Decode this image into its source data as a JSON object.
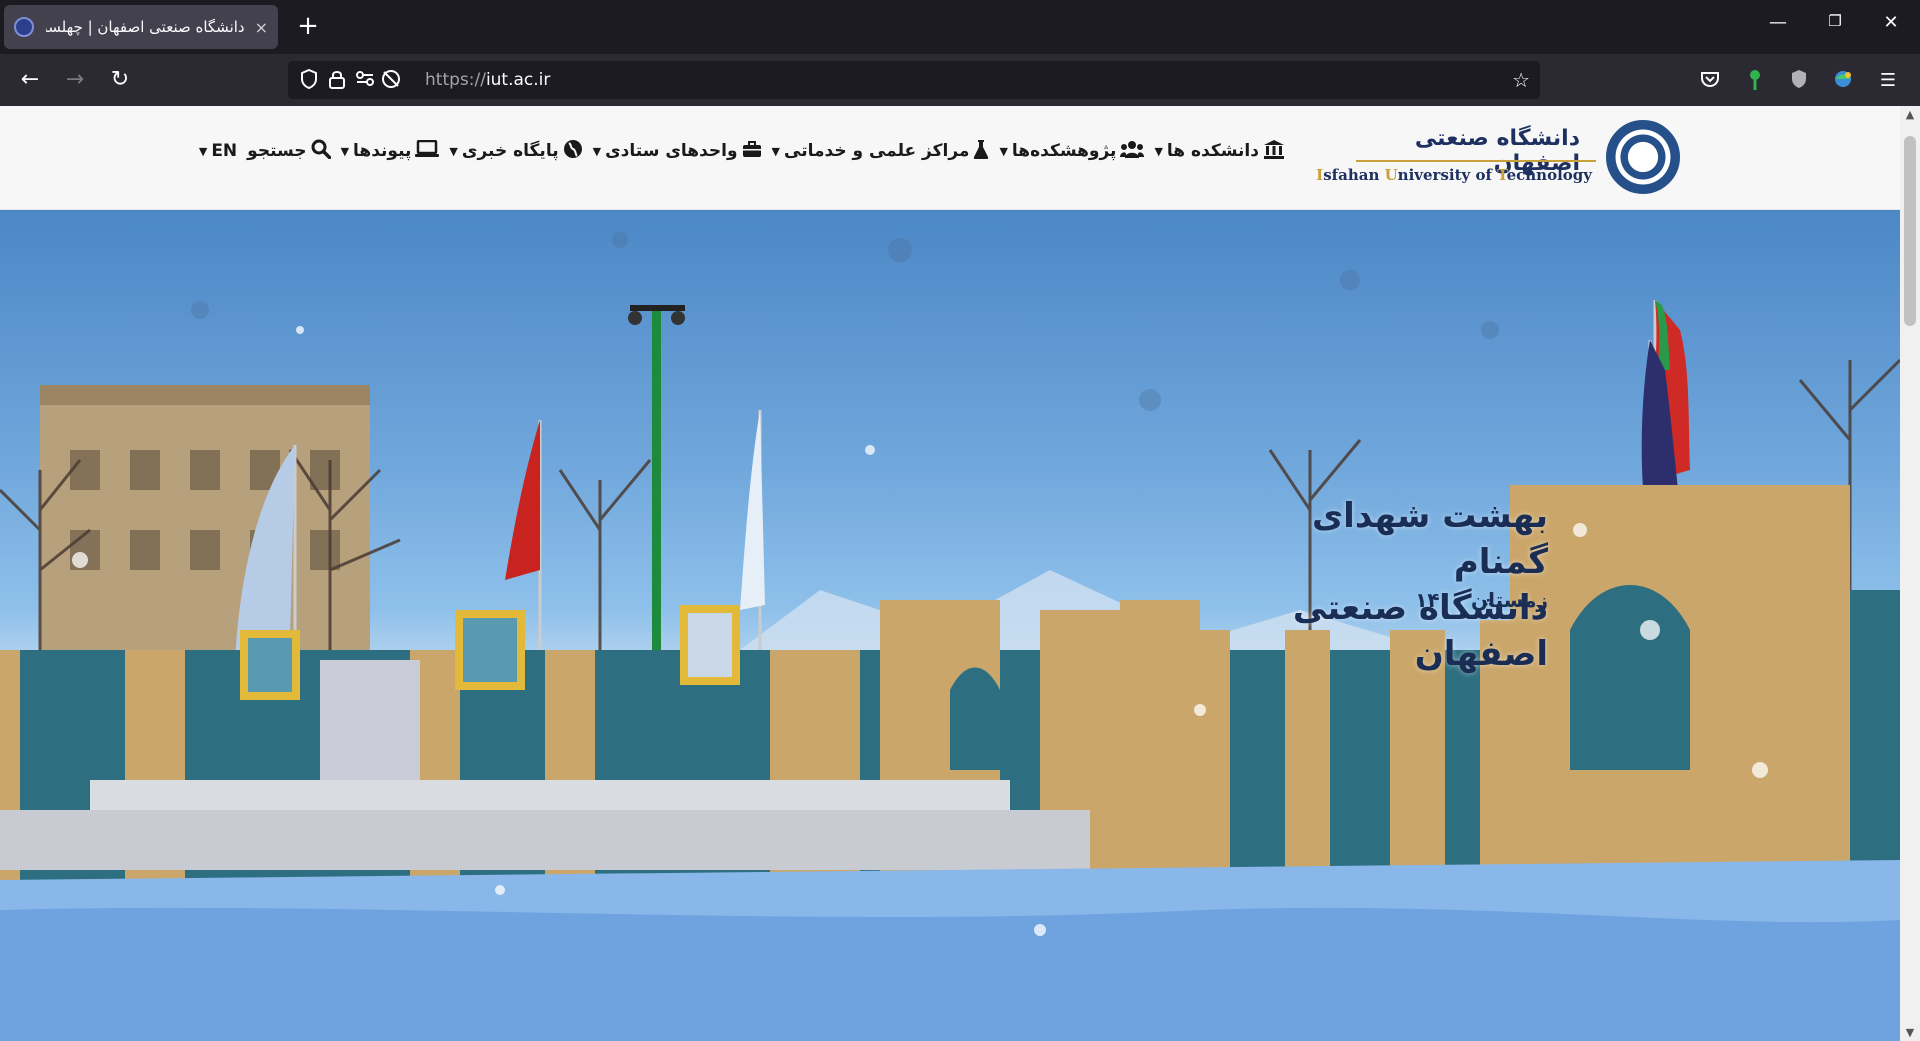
{
  "browser": {
    "tab_title": "دانشگاه صنعتی اصفهان | چهلسه",
    "tab_close": "×",
    "new_tab": "+",
    "url_scheme": "https://",
    "url_host": "iut.ac.ir",
    "window": {
      "minimize": "—",
      "restore": "❐",
      "close": "✕"
    },
    "nav": {
      "back": "←",
      "forward": "→",
      "reload": "↻"
    }
  },
  "site": {
    "logo_fa": "دانشگاه صنعتی اصفهان",
    "logo_en_parts": [
      "I",
      "sfahan ",
      "U",
      "niversity of ",
      "T",
      "echnology"
    ],
    "nav": [
      {
        "label": "دانشکده ها",
        "icon": "university-icon",
        "glyph": "🏛"
      },
      {
        "label": "پژوهشکده‌ها",
        "icon": "users-icon",
        "glyph": "👥"
      },
      {
        "label": "مراکز علمی و خدماتی",
        "icon": "flask-icon",
        "glyph": "⚗"
      },
      {
        "label": "واحدهای ستادی",
        "icon": "briefcase-icon",
        "glyph": "💼"
      },
      {
        "label": "پایگاه خبری",
        "icon": "globe-icon",
        "glyph": "🌍"
      },
      {
        "label": "پیوندها",
        "icon": "laptop-icon",
        "glyph": "💻"
      },
      {
        "label": "جستجو",
        "icon": "search-icon",
        "glyph": "🔍"
      },
      {
        "label": "EN",
        "icon": "",
        "glyph": ""
      }
    ]
  },
  "hero": {
    "title_line1": "بهشت شهدای گمنام",
    "title_line2": "دانشگاه صنعتی اصفهان",
    "subtitle": "زمستان ۱۴۰۰"
  }
}
